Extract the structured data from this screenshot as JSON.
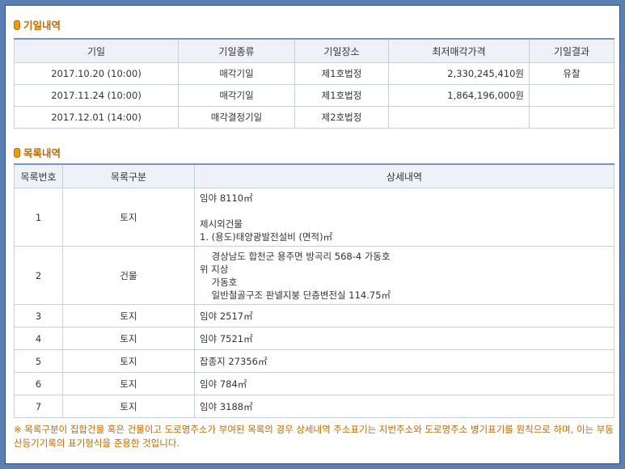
{
  "auction_section": {
    "title": "기일내역",
    "headers": [
      "기일",
      "기일종류",
      "기일장소",
      "최저매각가격",
      "기일결과"
    ],
    "rows": [
      {
        "date": "2017.10.20 (10:00)",
        "type": "매각기일",
        "place": "제1호법정",
        "price": "2,330,245,410원",
        "result": "유찰"
      },
      {
        "date": "2017.11.24 (10:00)",
        "type": "매각기일",
        "place": "제1호법정",
        "price": "1,864,196,000원",
        "result": ""
      },
      {
        "date": "2017.12.01 (14:00)",
        "type": "매각결정기일",
        "place": "제2호법정",
        "price": "",
        "result": ""
      }
    ]
  },
  "items_section": {
    "title": "목록내역",
    "headers": [
      "목록번호",
      "목록구분",
      "상세내역"
    ],
    "rows": [
      {
        "no": "1",
        "kind": "토지",
        "lines": [
          "임야 8110㎡",
          "",
          "제시외건물",
          "1. (용도)태양광발전설비 (면적)㎡"
        ]
      },
      {
        "no": "2",
        "kind": "건물",
        "lines": [
          "    경상남도 합천군 용주면 방곡리 568-4 가동호",
          "위 지상",
          "    가동호",
          "    일반철골구조 판넬지붕 단층변전실 114.75㎡"
        ]
      },
      {
        "no": "3",
        "kind": "토지",
        "lines": [
          "임야 2517㎡"
        ]
      },
      {
        "no": "4",
        "kind": "토지",
        "lines": [
          "임야 7521㎡"
        ]
      },
      {
        "no": "5",
        "kind": "토지",
        "lines": [
          "잡종지 27356㎡"
        ]
      },
      {
        "no": "6",
        "kind": "토지",
        "lines": [
          "임야 784㎡"
        ]
      },
      {
        "no": "7",
        "kind": "토지",
        "lines": [
          "임야 3188㎡"
        ]
      }
    ]
  },
  "footnote": "※ 목록구분이 집합건물 혹은 건물이고 도로명주소가 부여된 목록의 경우 상세내역 주소표기는 지번주소와 도로명주소 병기표기를 원칙으로 하며, 이는 부동산등기기록의 표기형식을 준용한 것입니다.",
  "colors": {
    "accent": "#c06a00",
    "header_bg": "#eef2f8",
    "border": "#c7d0dd",
    "outer": "#5b7fb3"
  }
}
